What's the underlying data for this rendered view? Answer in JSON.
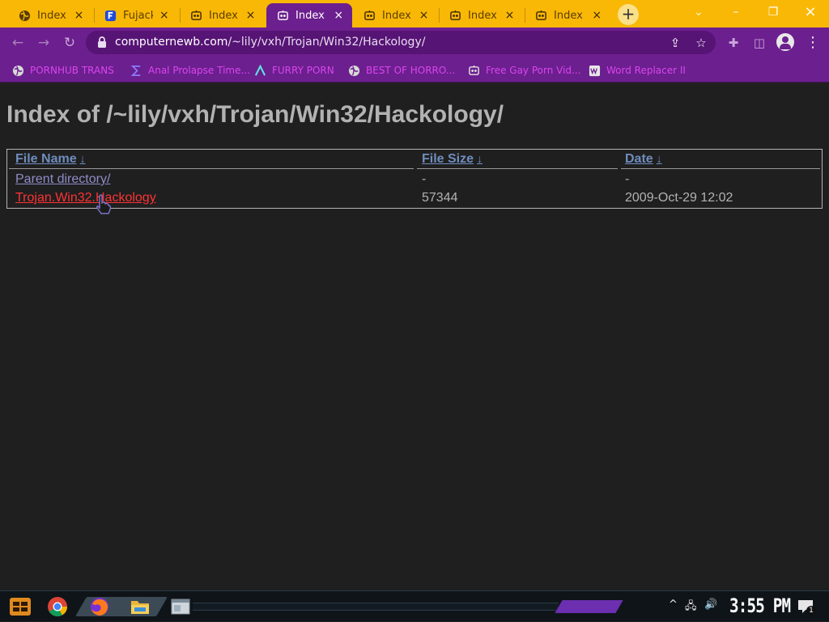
{
  "browser": {
    "tabs": [
      {
        "title": "Index o",
        "icon": "globe-icon",
        "active": false
      },
      {
        "title": "Fujack",
        "icon": "f-logo-icon",
        "active": false
      },
      {
        "title": "Index o",
        "icon": "robot-icon",
        "active": false
      },
      {
        "title": "Index o",
        "icon": "robot-icon",
        "active": true
      },
      {
        "title": "Index o",
        "icon": "robot-icon",
        "active": false
      },
      {
        "title": "Index o",
        "icon": "robot-icon",
        "active": false
      },
      {
        "title": "Index o",
        "icon": "robot-icon",
        "active": false
      }
    ],
    "tab_close_glyph": "×",
    "new_tab_glyph": "+",
    "window_controls": {
      "dropdown": "⌄",
      "minimize": "–",
      "restore": "❐",
      "close": "×"
    },
    "nav": {
      "back": "←",
      "forward": "→",
      "reload": "↻"
    },
    "address": {
      "host": "computernewb.com",
      "path": "/~lily/vxh/Trojan/Win32/Hackology/"
    },
    "omnibox_actions": {
      "share": "⇪",
      "bookmark": "☆"
    },
    "toolbar_icons": {
      "extensions": "✚",
      "sidepanel": "◫",
      "menu": "⋮"
    },
    "bookmarks": [
      {
        "label": "PORNHUB TRANS",
        "icon": "globe-icon"
      },
      {
        "label": "Anal Prolapse Time...",
        "icon": "sigma-icon"
      },
      {
        "label": "FURRY PORN",
        "icon": "lambda-icon"
      },
      {
        "label": "BEST OF HORRO...",
        "icon": "globe-icon"
      },
      {
        "label": "Free Gay Porn Vid...",
        "icon": "robot-icon"
      },
      {
        "label": "Word Replacer II",
        "icon": "wr-icon"
      }
    ],
    "colors": {
      "tabstrip": "#f9b806",
      "toolbar": "#6c1f8e",
      "bookmark_text": "#d946ef"
    }
  },
  "page": {
    "heading": "Index of /~lily/vxh/Trojan/Win32/Hackology/",
    "columns": {
      "name": "File Name",
      "size": "File Size",
      "date": "Date",
      "sort_glyph": "↓"
    },
    "rows": [
      {
        "name": "Parent directory/",
        "size": "-",
        "date": "-"
      },
      {
        "name": "Trojan.Win32.Hackology",
        "size": "57344",
        "date": "2009-Oct-29 12:02"
      }
    ],
    "colors": {
      "background": "#1f1f1f",
      "link": "#8d8dc8",
      "hover_link": "#ff3333",
      "header_link": "#6f8dbd"
    }
  },
  "taskbar": {
    "apps": [
      "start-icon",
      "chrome-icon",
      "firefox-icon",
      "file-explorer-icon",
      "window-icon"
    ],
    "tray": {
      "chevron": "^",
      "network": "🖧",
      "volume": "🔊",
      "notifications_count": "1"
    },
    "clock": "3:55 PM"
  }
}
